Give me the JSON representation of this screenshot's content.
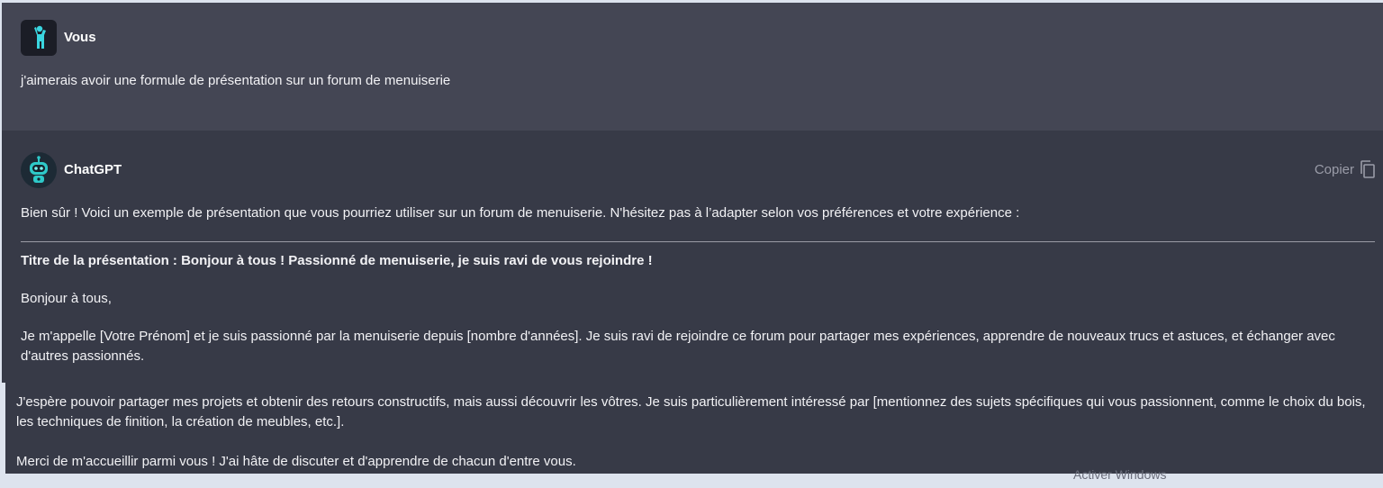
{
  "user_message": {
    "author": "Vous",
    "text": "j'aimerais avoir une formule de présentation sur un forum de menuiserie"
  },
  "assistant_message": {
    "author": "ChatGPT",
    "copy_label": "Copier",
    "intro": "Bien sûr ! Voici un exemple de présentation que vous pourriez utiliser sur un forum de menuiserie. N'hésitez pas à l’adapter selon vos préférences et votre expérience :",
    "title_line": "Titre de la présentation : Bonjour à tous ! Passionné de menuiserie, je suis ravi de vous rejoindre !",
    "greeting": "Bonjour à tous,",
    "paragraph1": "Je m'appelle [Votre Prénom] et je suis passionné par la menuiserie depuis [nombre d'années]. Je suis ravi de rejoindre ce forum pour partager mes expériences, apprendre de nouveaux trucs et astuces, et échanger avec d'autres passionnés.",
    "paragraph2": "J'espère pouvoir partager mes projets et obtenir des retours constructifs, mais aussi découvrir les vôtres. Je suis particulièrement intéressé par [mentionnez des sujets spécifiques qui vous passionnent, comme le choix du bois, les techniques de finition, la création de meubles, etc.].",
    "paragraph3": "Merci de m'accueillir parmi vous ! J'ai hâte de discuter et d'apprendre de chacun d'entre vous."
  },
  "watermark": "Activer Windows",
  "icons": {
    "user_avatar": "person-icon",
    "bot_avatar": "robot-icon",
    "copy": "copy-icon"
  },
  "colors": {
    "user_background": "#444654",
    "assistant_background": "#373a47",
    "page_background": "#dde3ee",
    "user_avatar_accent": "#3ad6e0",
    "bot_avatar_accent": "#2ec9c9"
  }
}
